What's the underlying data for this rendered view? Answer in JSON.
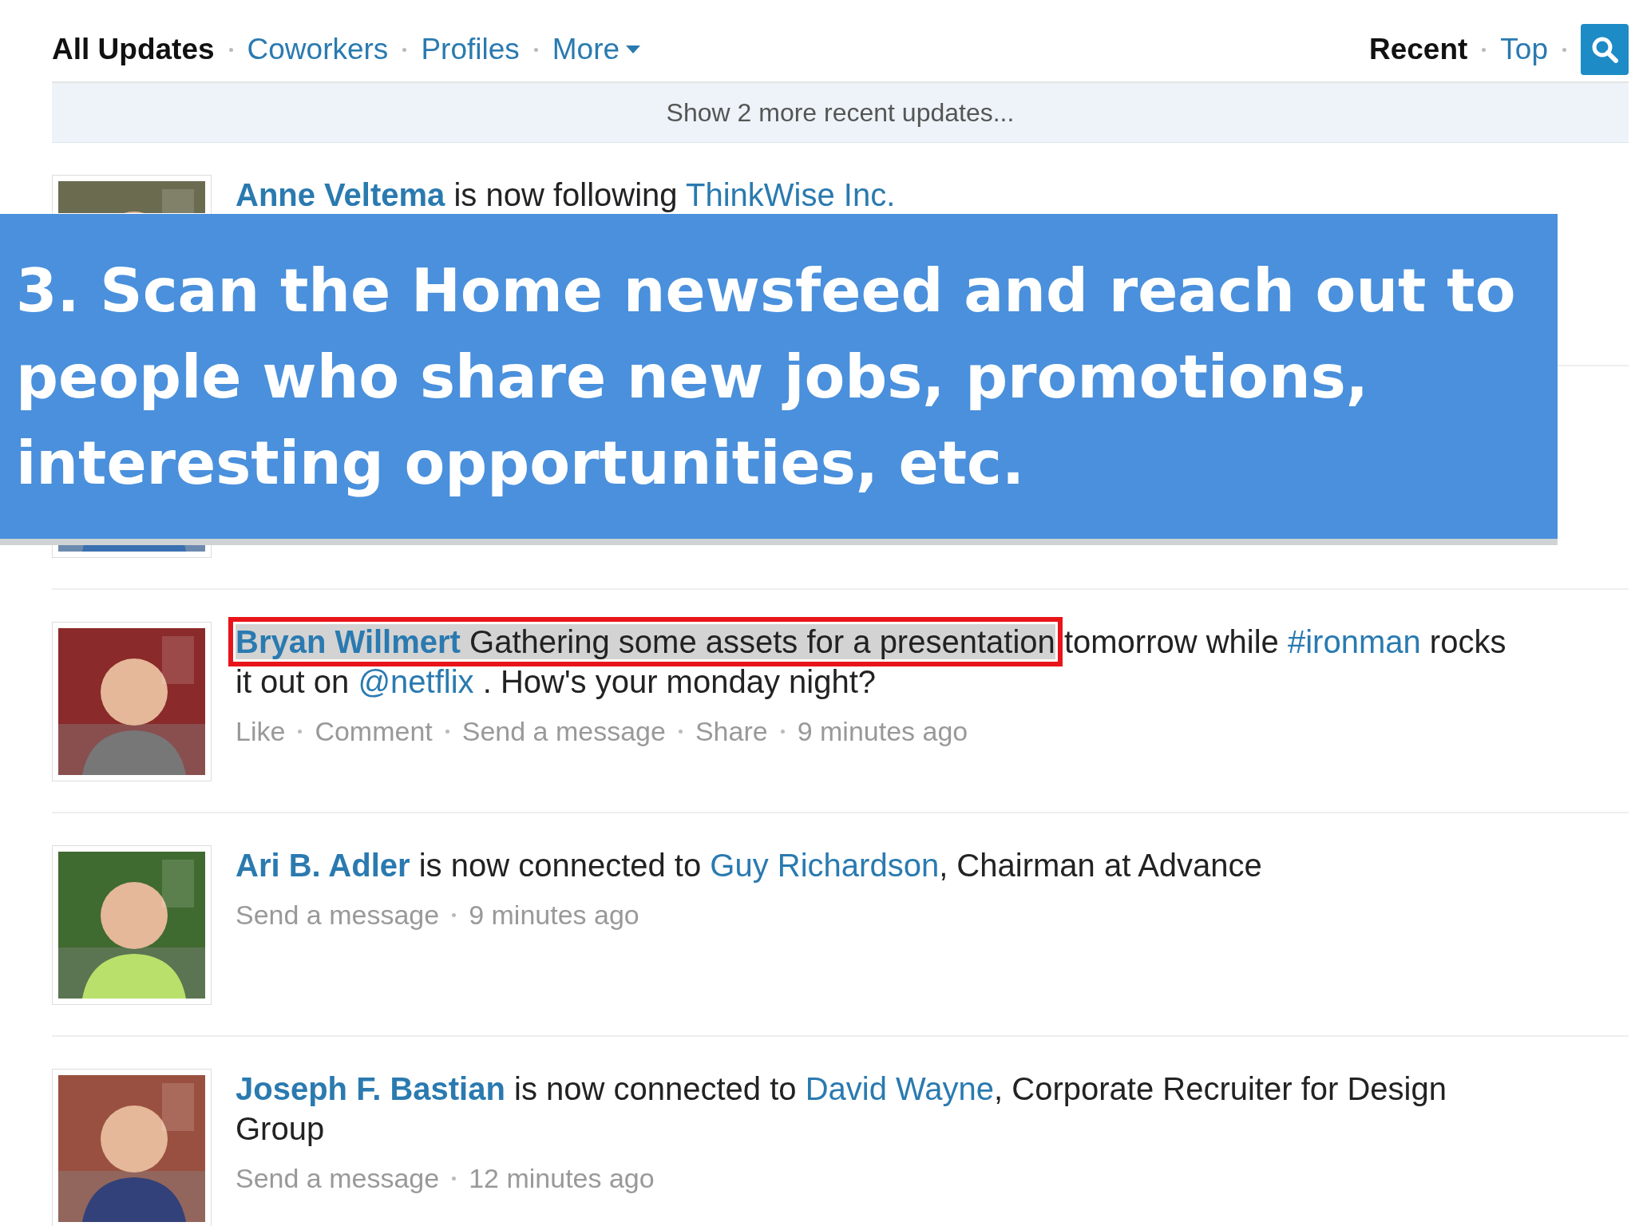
{
  "nav": {
    "tabs": [
      {
        "label": "All Updates",
        "selected": true
      },
      {
        "label": "Coworkers",
        "selected": false
      },
      {
        "label": "Profiles",
        "selected": false
      },
      {
        "label": "More",
        "selected": false,
        "kind": "dropdown"
      }
    ],
    "sort": [
      {
        "label": "Recent",
        "selected": true
      },
      {
        "label": "Top",
        "selected": false
      }
    ]
  },
  "show_more": "Show 2 more recent updates...",
  "feed": [
    {
      "avatar": {
        "kind": "picture"
      },
      "segments": [
        {
          "kind": "name",
          "text": "Anne Veltema"
        },
        {
          "kind": "plain",
          "text": " is now following "
        },
        {
          "kind": "link",
          "text": "ThinkWise Inc."
        }
      ]
    },
    {
      "avatar": {
        "kind": "picture"
      }
    },
    {
      "avatar": {
        "kind": "picture"
      },
      "segments": [
        {
          "kind": "name",
          "text": "Bryan Willmert",
          "highlighted": true
        },
        {
          "kind": "plain",
          "text": " Gathering some assets for a presentation",
          "highlighted": true
        },
        {
          "kind": "plain",
          "text": " tomorrow while "
        },
        {
          "kind": "link",
          "text": "#ironman"
        },
        {
          "kind": "plain",
          "text": " rocks it out on "
        },
        {
          "kind": "link",
          "text": "@netflix"
        },
        {
          "kind": "plain",
          "text": " . How's your monday night?"
        }
      ],
      "actions": [
        "Like",
        "Comment",
        "Send a message",
        "Share",
        "9 minutes ago"
      ]
    },
    {
      "avatar": {
        "kind": "picture"
      },
      "segments": [
        {
          "kind": "name",
          "text": "Ari B. Adler"
        },
        {
          "kind": "plain",
          "text": " is now connected to "
        },
        {
          "kind": "link",
          "text": "Guy Richardson"
        },
        {
          "kind": "plain",
          "text": ", Chairman at Advance"
        }
      ],
      "actions": [
        "Send a message",
        "9 minutes ago"
      ]
    },
    {
      "avatar": {
        "kind": "picture"
      },
      "segments": [
        {
          "kind": "name",
          "text": "Joseph F. Bastian"
        },
        {
          "kind": "plain",
          "text": " is now connected to "
        },
        {
          "kind": "link",
          "text": "David Wayne"
        },
        {
          "kind": "plain",
          "text": ", Corporate Recruiter for Design Group"
        }
      ],
      "actions": [
        "Send a message",
        "12 minutes ago"
      ]
    }
  ],
  "banner": {
    "text": "3. Scan the Home newsfeed and reach out to people who share new jobs, promotions, interesting opportunities, etc."
  }
}
